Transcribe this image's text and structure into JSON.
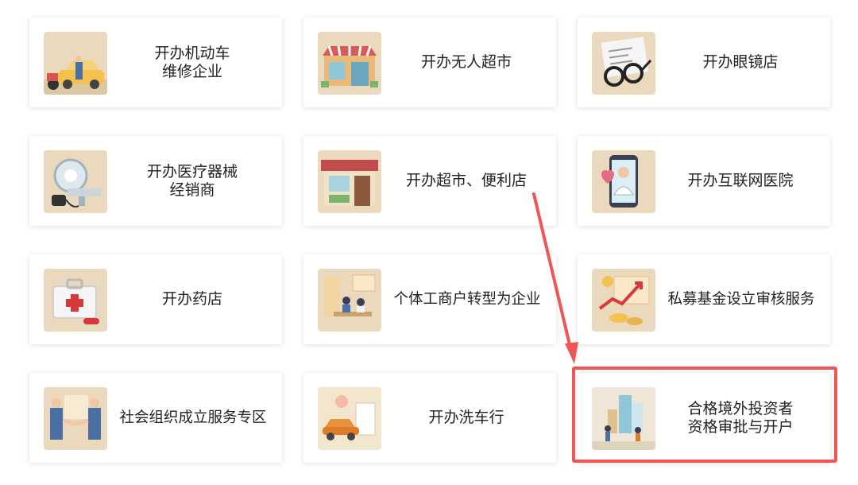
{
  "services": [
    {
      "label": "开办机动车\n维修企业",
      "icon": "car-repair-icon"
    },
    {
      "label": "开办无人超市",
      "icon": "unmanned-store-icon"
    },
    {
      "label": "开办眼镜店",
      "icon": "glasses-icon"
    },
    {
      "label": "开办医疗器械\n经销商",
      "icon": "medical-device-icon"
    },
    {
      "label": "开办超市、便利店",
      "icon": "convenience-store-icon"
    },
    {
      "label": "开办互联网医院",
      "icon": "online-doctor-icon"
    },
    {
      "label": "开办药店",
      "icon": "first-aid-kit-icon"
    },
    {
      "label": "个体工商户转型为企业",
      "icon": "office-transform-icon"
    },
    {
      "label": "私募基金设立审核服务",
      "icon": "fund-growth-icon"
    },
    {
      "label": "社会组织成立服务专区",
      "icon": "handshake-icon"
    },
    {
      "label": "开办洗车行",
      "icon": "car-wash-icon"
    },
    {
      "label": "合格境外投资者\n资格审批与开户",
      "icon": "foreign-investor-icon"
    }
  ],
  "annotation": {
    "color": "#f05656",
    "highlighted_item": "合格境外投资者资格审批与开户"
  }
}
